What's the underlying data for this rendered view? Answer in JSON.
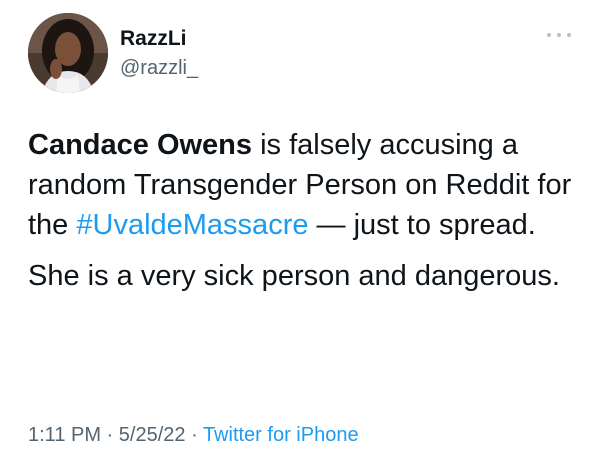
{
  "author": {
    "display_name": "RazzLi",
    "handle": "@razzli_"
  },
  "tweet": {
    "mention": "Candace Owens",
    "text_part1": " is falsely accusing a random Transgender Person on Reddit for the ",
    "hashtag": "#UvaldeMassacre",
    "text_part2": " — just to spread.",
    "paragraph2": "She is a very sick person and dangerous."
  },
  "meta": {
    "time": "1:11 PM",
    "sep1": " · ",
    "date": "5/25/22",
    "sep2": " · ",
    "source": "Twitter for iPhone"
  },
  "icons": {
    "more": "more-options-icon"
  },
  "colors": {
    "link": "#1d9bf0",
    "secondary_text": "#536471",
    "primary_text": "#0f1419"
  }
}
